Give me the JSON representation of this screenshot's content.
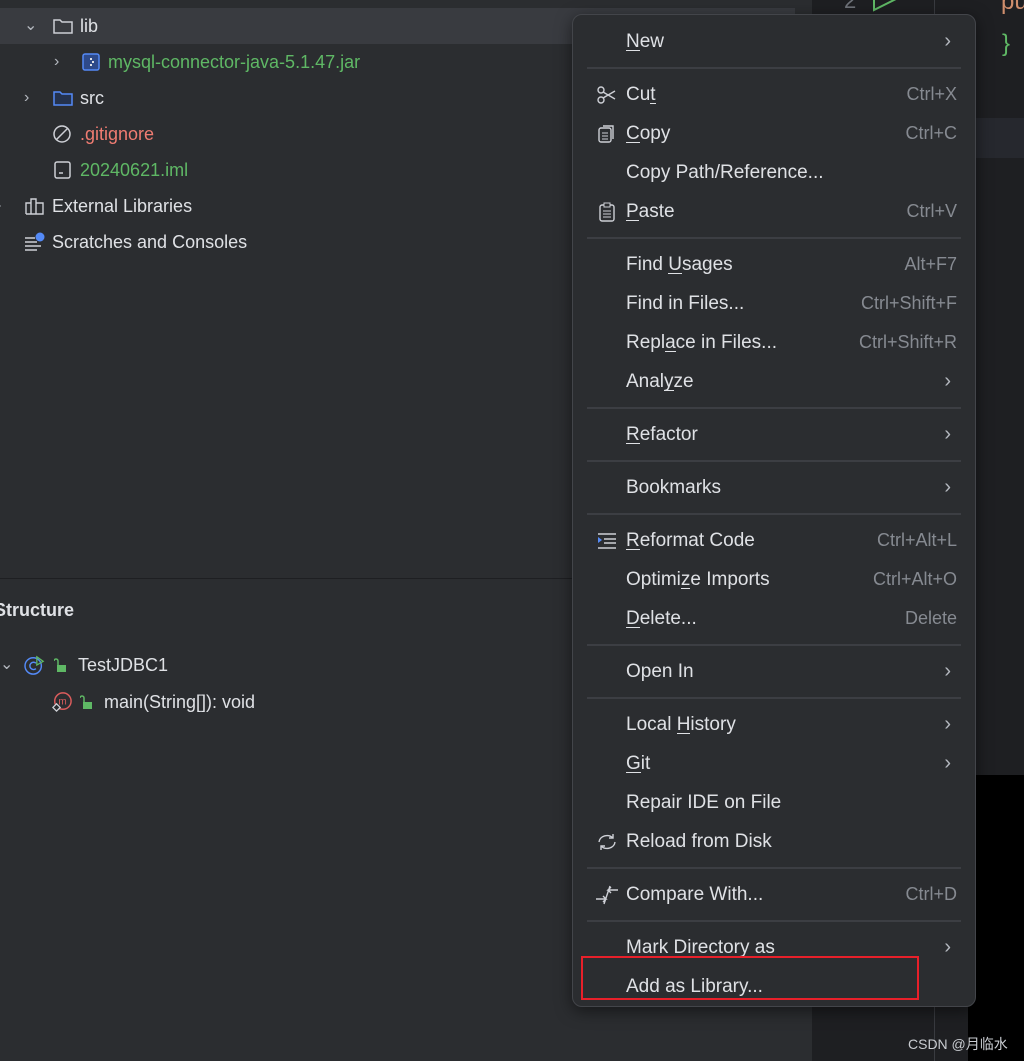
{
  "project_tree": {
    "items": [
      {
        "label": "lib",
        "expanded": true,
        "selected": true,
        "icon": "folder-icon"
      },
      {
        "label": "mysql-connector-java-5.1.47.jar",
        "icon": "jar-icon"
      },
      {
        "label": "src",
        "icon": "source-folder-icon"
      },
      {
        "label": ".gitignore",
        "icon": "ignored-file-icon"
      },
      {
        "label": "20240621.iml",
        "icon": "module-file-icon"
      },
      {
        "label": "External Libraries",
        "icon": "libraries-icon"
      },
      {
        "label": "Scratches and Consoles",
        "icon": "scratches-icon"
      }
    ]
  },
  "structure": {
    "title": "Structure",
    "items": [
      {
        "label": "TestJDBC1",
        "icon": "class-icon"
      },
      {
        "label": "main(String[]): void",
        "icon": "method-icon"
      }
    ]
  },
  "editor": {
    "line_number": "2",
    "code_fragment": "pu",
    "brace": "}"
  },
  "context_menu": {
    "items": [
      {
        "label": "New",
        "mn": 0,
        "submenu": true
      },
      {
        "sep": true
      },
      {
        "label": "Cut",
        "mn": 2,
        "shortcut": "Ctrl+X",
        "icon": "scissors-icon"
      },
      {
        "label": "Copy",
        "mn": 0,
        "shortcut": "Ctrl+C",
        "icon": "copy-icon"
      },
      {
        "label": "Copy Path/Reference...",
        "mn": -1
      },
      {
        "label": "Paste",
        "mn": 0,
        "shortcut": "Ctrl+V",
        "icon": "paste-icon"
      },
      {
        "sep": true
      },
      {
        "label": "Find Usages",
        "mn": 5,
        "shortcut": "Alt+F7"
      },
      {
        "label": "Find in Files...",
        "mn": -1,
        "shortcut": "Ctrl+Shift+F"
      },
      {
        "label": "Replace in Files...",
        "mn": 4,
        "shortcut": "Ctrl+Shift+R"
      },
      {
        "label": "Analyze",
        "mn": 4,
        "submenu": true
      },
      {
        "sep": true
      },
      {
        "label": "Refactor",
        "mn": 0,
        "submenu": true
      },
      {
        "sep": true
      },
      {
        "label": "Bookmarks",
        "mn": -1,
        "submenu": true
      },
      {
        "sep": true
      },
      {
        "label": "Reformat Code",
        "mn": 0,
        "shortcut": "Ctrl+Alt+L",
        "icon": "reformat-icon"
      },
      {
        "label": "Optimize Imports",
        "mn": 6,
        "shortcut": "Ctrl+Alt+O"
      },
      {
        "label": "Delete...",
        "mn": 0,
        "shortcut": "Delete"
      },
      {
        "sep": true
      },
      {
        "label": "Open In",
        "mn": -1,
        "submenu": true
      },
      {
        "sep": true
      },
      {
        "label": "Local History",
        "mn": 6,
        "submenu": true
      },
      {
        "label": "Git",
        "mn": 0,
        "submenu": true
      },
      {
        "label": "Repair IDE on File",
        "mn": -1
      },
      {
        "label": "Reload from Disk",
        "mn": -1,
        "icon": "reload-icon"
      },
      {
        "sep": true
      },
      {
        "label": "Compare With...",
        "mn": -1,
        "shortcut": "Ctrl+D",
        "icon": "compare-icon"
      },
      {
        "sep": true
      },
      {
        "label": "Mark Directory as",
        "mn": -1,
        "submenu": true
      },
      {
        "label": "Add as Library...",
        "mn": -1,
        "highlighted_box": true
      }
    ]
  },
  "colors": {
    "highlight_box": "#e8202a",
    "vcs_added": "#5fb865",
    "vcs_ignored": "#f07c72"
  },
  "watermark": "CSDN @月临水"
}
